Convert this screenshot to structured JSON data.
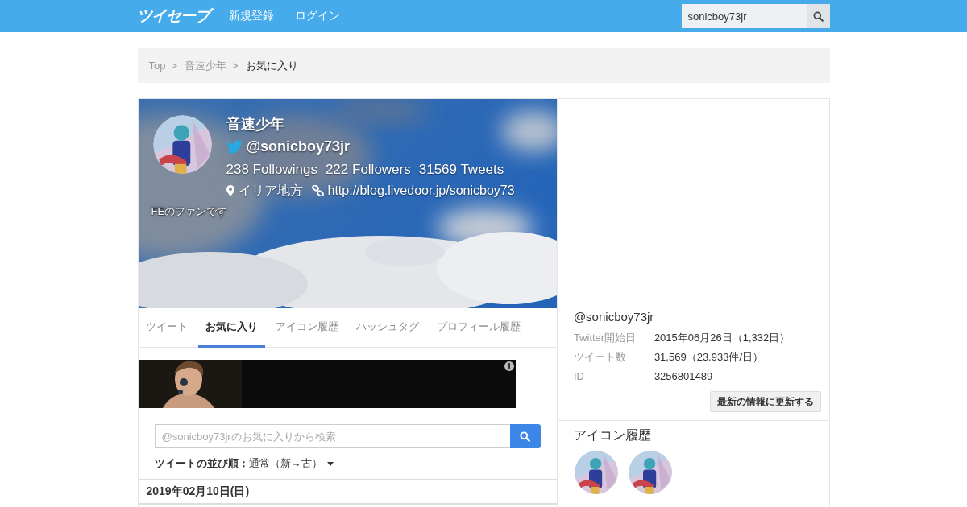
{
  "navbar": {
    "logo": "ツイセーブ",
    "links": [
      "新規登録",
      "ログイン"
    ],
    "search": {
      "value": "sonicboy73jr"
    }
  },
  "breadcrumb": {
    "items": [
      {
        "label": "Top",
        "current": false
      },
      {
        "label": "音速少年",
        "current": false
      },
      {
        "label": "お気に入り",
        "current": true
      }
    ],
    "separators": [
      ">",
      ">"
    ]
  },
  "profile": {
    "name": "音速少年",
    "handle": "@sonicboy73jr",
    "stats": [
      {
        "count": "238",
        "label": "Followings"
      },
      {
        "count": "222",
        "label": "Followers"
      },
      {
        "count": "31569",
        "label": "Tweets"
      }
    ],
    "location": "イリア地方",
    "url": "http://blog.livedoor.jp/sonicboy73",
    "bio": "FEのファンです"
  },
  "tabs": [
    {
      "label": "ツイート",
      "selected": false
    },
    {
      "label": "お気に入り",
      "selected": true
    },
    {
      "label": "アイコン履歴",
      "selected": false
    },
    {
      "label": "ハッシュタグ",
      "selected": false
    },
    {
      "label": "プロフィール履歴",
      "selected": false
    }
  ],
  "search": {
    "placeholder": "@sonicboy73jrのお気に入りから検索"
  },
  "sort": {
    "label": "ツイートの並び順：",
    "value": "通常（新→古）"
  },
  "date_header": "2019年02月10日(日)",
  "sidebar": {
    "handle": "@sonicboy73jr",
    "info": [
      {
        "label": "Twitter開始日",
        "value": "2015年06月26日（1,332日）"
      },
      {
        "label": "ツイート数",
        "value": "31,569（23.933件/日）"
      },
      {
        "label": "ID",
        "value": "3256801489"
      }
    ],
    "update_button": "最新の情報に更新する",
    "icon_history": {
      "title": "アイコン履歴"
    }
  }
}
